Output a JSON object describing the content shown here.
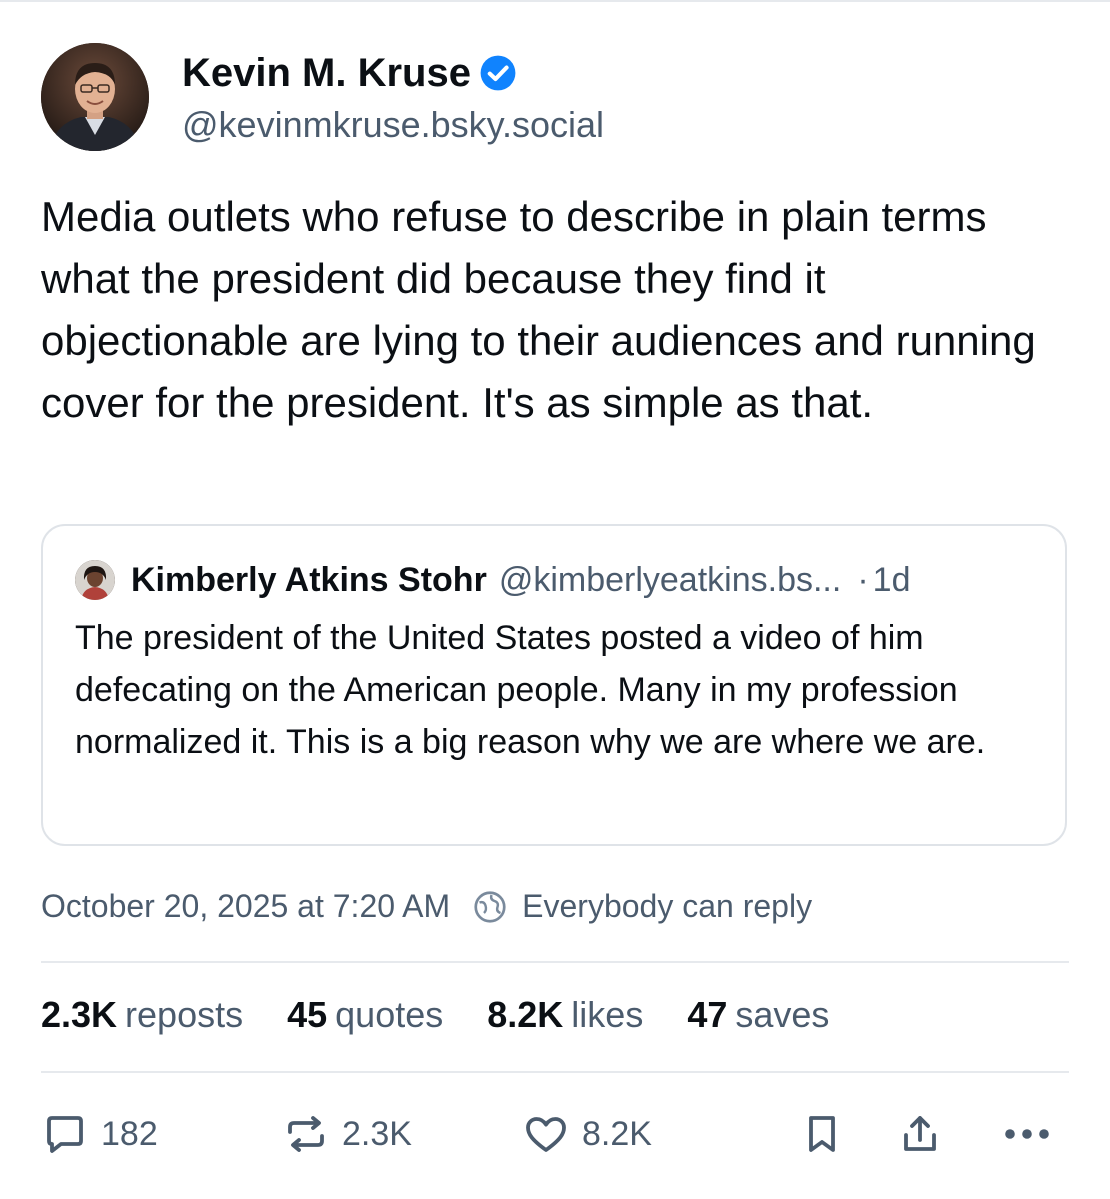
{
  "author": {
    "display_name": "Kevin M. Kruse",
    "handle": "@kevinmkruse.bsky.social",
    "verified": true
  },
  "post": {
    "text": "Media outlets who refuse to describe in plain terms what the president did because they find it objectionable are lying to their audiences and running cover for the president. It's as simple as that."
  },
  "quote": {
    "display_name": "Kimberly Atkins Stohr",
    "handle": "@kimberlyeatkins.bs...",
    "separator": "·",
    "time": "1d",
    "text": "The president of the United States posted a video of him defecating on the American people. Many in my profession normalized it. This is a big reason why we are where we are."
  },
  "meta": {
    "timestamp": "October 20, 2025 at 7:20 AM",
    "reply_setting": "Everybody can reply"
  },
  "stats": {
    "reposts_count": "2.3K",
    "reposts_label": "reposts",
    "quotes_count": "45",
    "quotes_label": "quotes",
    "likes_count": "8.2K",
    "likes_label": "likes",
    "saves_count": "47",
    "saves_label": "saves"
  },
  "actions": {
    "reply_count": "182",
    "repost_count": "2.3K",
    "like_count": "8.2K"
  },
  "icons": {
    "verified": "verified-badge-icon",
    "reply_setting": "globe-icon",
    "reply": "speech-bubble-icon",
    "repost": "repost-arrows-icon",
    "like": "heart-icon",
    "save": "bookmark-icon",
    "share": "share-icon",
    "more": "more-dots-icon"
  },
  "colors": {
    "text_primary": "#0b0f14",
    "text_secondary": "#4b5b6d",
    "verified_blue": "#1083fe",
    "border": "#dfe3e8"
  }
}
